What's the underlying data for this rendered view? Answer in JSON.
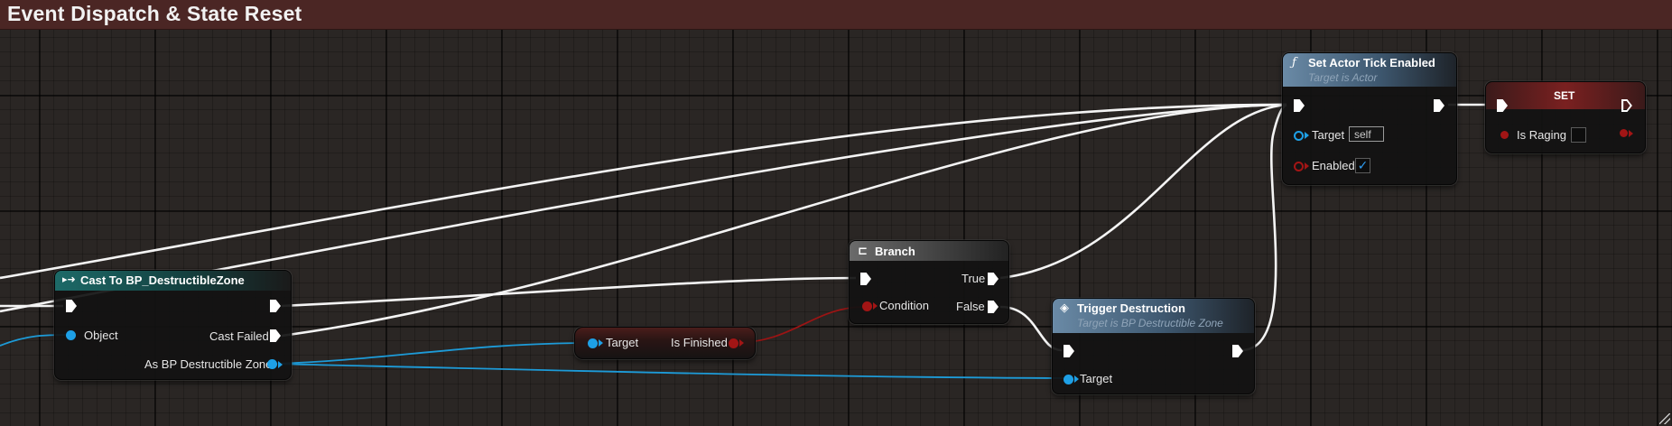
{
  "graph": {
    "title": "Event Dispatch & State Reset"
  },
  "nodes": {
    "cast": {
      "title": "Cast To BP_DestructibleZone",
      "object_label": "Object",
      "cast_failed_label": "Cast Failed",
      "as_label": "As BP Destructible Zone"
    },
    "is_finished": {
      "target_label": "Target",
      "output_label": "Is Finished"
    },
    "branch": {
      "title": "Branch",
      "condition_label": "Condition",
      "true_label": "True",
      "false_label": "False"
    },
    "trigger": {
      "title": "Trigger Destruction",
      "subtitle": "Target is BP Destructible Zone",
      "target_label": "Target"
    },
    "set_tick": {
      "title": "Set Actor Tick Enabled",
      "subtitle": "Target is Actor",
      "target_label": "Target",
      "target_value": "self",
      "enabled_label": "Enabled",
      "enabled_check": "✓"
    },
    "set_var": {
      "title": "SET",
      "var_label": "Is Raging"
    }
  },
  "icons": {
    "function": "ƒ",
    "cast": "▸➜",
    "branch": "⊏",
    "event": "◈"
  },
  "colors": {
    "exec_wire": "#f4f4f4",
    "object_pin": "#1ea0e6",
    "bool_pin": "#a21515",
    "title_bar": "#4b2624"
  }
}
